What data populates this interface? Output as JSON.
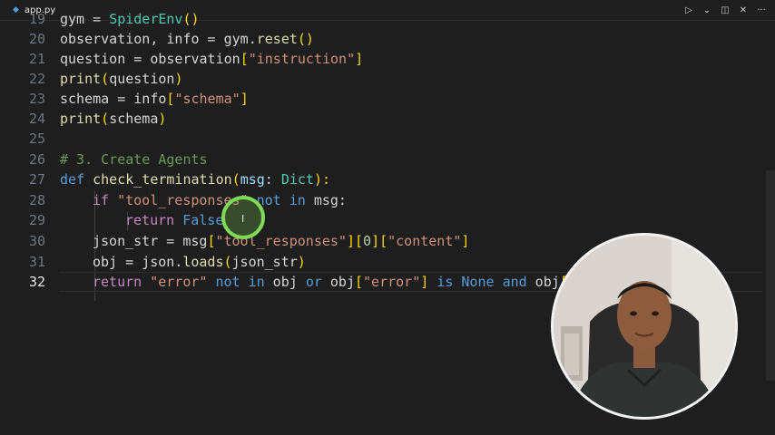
{
  "tab": {
    "filename": "app.py",
    "icon": "python-file-icon"
  },
  "actions": {
    "run": "▷",
    "run_menu": "⌄",
    "split": "◫",
    "close": "✕",
    "more": "···"
  },
  "editor": {
    "line_numbers": [
      "19",
      "20",
      "21",
      "22",
      "23",
      "24",
      "25",
      "26",
      "27",
      "28",
      "29",
      "30",
      "31",
      "32"
    ],
    "active_line": "32",
    "l19": {
      "a": "gym = ",
      "b": "SpiderEnv",
      "c": "()"
    },
    "l20": {
      "a": "observation, info = gym.",
      "b": "reset",
      "c": "()"
    },
    "l21": {
      "a": "question = observation",
      "b": "[",
      "c": "\"instruction\"",
      "d": "]"
    },
    "l22": {
      "a": "print",
      "b": "(",
      "c": "question",
      "d": ")"
    },
    "l23": {
      "a": "schema = info",
      "b": "[",
      "c": "\"schema\"",
      "d": "]"
    },
    "l24": {
      "a": "print",
      "b": "(",
      "c": "schema",
      "d": ")"
    },
    "l26": {
      "a": "# 3. Create Agents"
    },
    "l27": {
      "a": "def",
      "b": " ",
      "c": "check_termination",
      "d": "(",
      "e": "msg",
      "f": ": ",
      "g": "Dict",
      "h": "):"
    },
    "l28": {
      "a": "if",
      "b": " ",
      "c": "\"tool_responses\"",
      "d": " ",
      "e": "not in",
      "f": " msg:"
    },
    "l29": {
      "a": "return",
      "b": " ",
      "c": "False"
    },
    "l30": {
      "a": "json_str = msg",
      "b": "[",
      "c": "\"tool_responses\"",
      "d": "]",
      "e": "[",
      "f": "0",
      "g": "]",
      "h": "[",
      "i": "\"content\"",
      "j": "]"
    },
    "l31": {
      "a": "obj = json.",
      "b": "loads",
      "c": "(",
      "d": "json_str",
      "e": ")"
    },
    "l32": {
      "a": "return",
      "b": " ",
      "c": "\"error\"",
      "d": " ",
      "e": "not in",
      "f": " obj ",
      "g": "or",
      "h": " obj",
      "i": "[",
      "j": "\"error\"",
      "k": "]",
      "l": " ",
      "m": "is",
      "n": " ",
      "o": "None",
      "p": " ",
      "q": "and",
      "r": " obj",
      "s": "[",
      "t": "\""
    }
  },
  "webcam": {
    "icon": "webcam-overlay"
  },
  "colors": {
    "background": "#1e1e1e",
    "keyword": "#569cd6",
    "string": "#ce9178",
    "function": "#dcdcaa",
    "comment": "#6a9955",
    "cursor_highlight": "#7ed957"
  }
}
